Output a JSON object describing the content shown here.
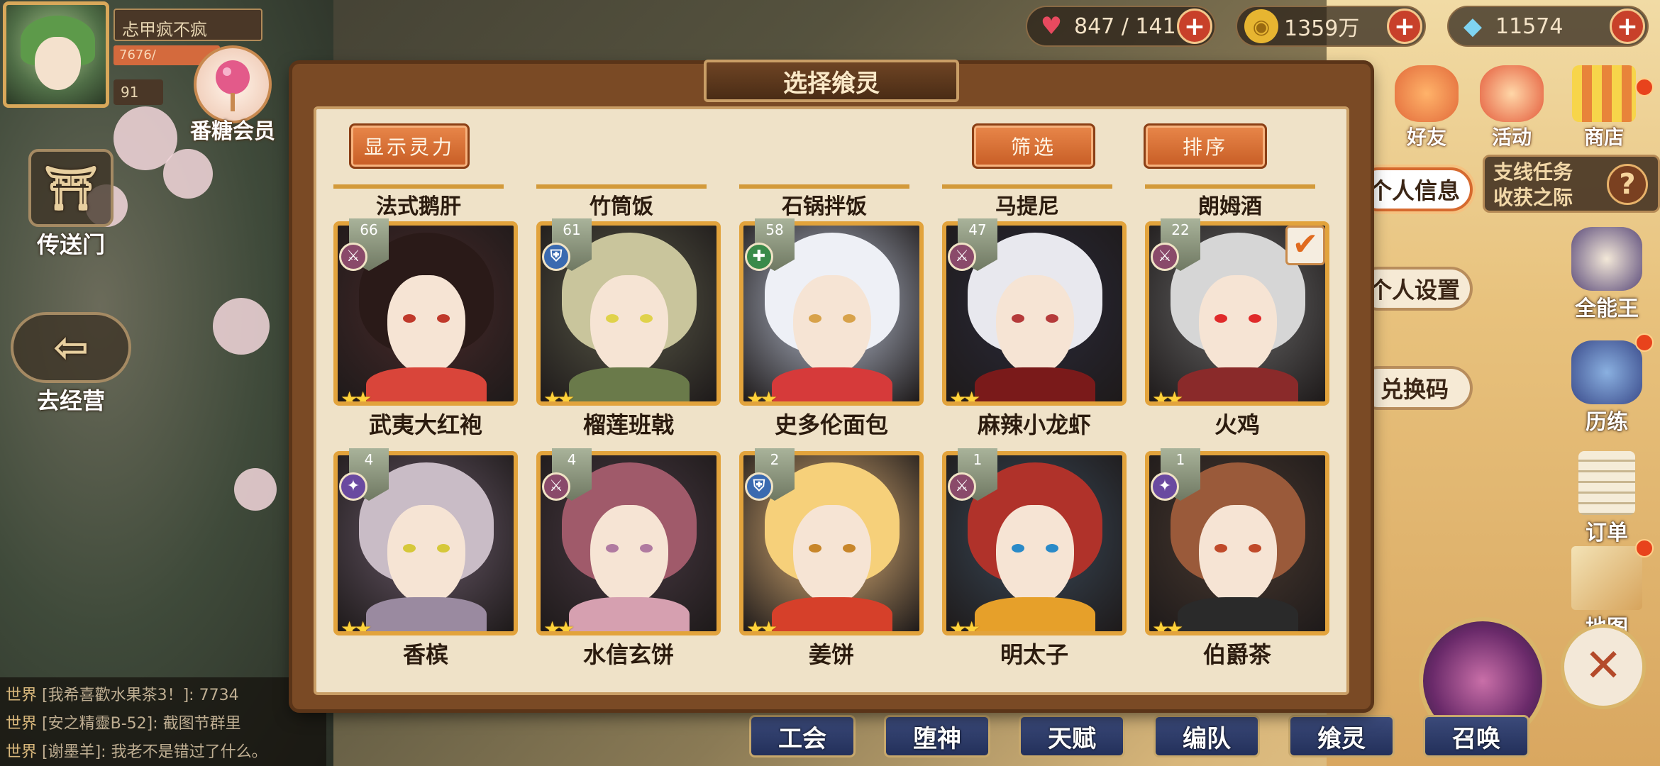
{
  "profile": {
    "player_name": "忐甲疯不疯",
    "exp_text": "7676/",
    "level": "91"
  },
  "left_menu": {
    "candy_member": "番糖会员",
    "portal": "传送门",
    "go_business": "去经营"
  },
  "resources": [
    {
      "icon": "heart-icon",
      "value": "847 / 141"
    },
    {
      "icon": "coin-icon",
      "value": "1359万"
    },
    {
      "icon": "crystal-icon",
      "value": "11574"
    }
  ],
  "top_right_icons": [
    {
      "label": "好友",
      "icon": "friends-icon"
    },
    {
      "label": "活动",
      "icon": "event-icon"
    },
    {
      "label": "商店",
      "icon": "shop-icon"
    }
  ],
  "side_menu": {
    "personal_info": "个人信息",
    "personal_settings": "个人设置",
    "redeem_code": "兑换码",
    "quest_line1": "支线任务",
    "quest_line2": "收获之际",
    "quest_help": "?"
  },
  "right_side": [
    {
      "label": "全能王"
    },
    {
      "label": "历练"
    },
    {
      "label": "订单"
    },
    {
      "label": "地图"
    }
  ],
  "chat": [
    {
      "channel": "世界",
      "text": "[我希喜歡水果茶3！]: 7734"
    },
    {
      "channel": "世界",
      "text": "[安之精靈B-52]: 截图节群里"
    },
    {
      "channel": "世界",
      "text": "[谢墨羊]: 我老不是错过了什么。"
    }
  ],
  "bottom_tabs": [
    "工会",
    "堕神",
    "天赋",
    "编队",
    "飨灵",
    "召唤"
  ],
  "modal": {
    "title": "选择飨灵",
    "show_power": "显示灵力",
    "filter": "筛选",
    "sort": "排序",
    "top_row_names": [
      "法式鹅肝",
      "竹筒饭",
      "石锅拌饭",
      "马提尼",
      "朗姆酒"
    ],
    "cards": [
      {
        "name": "武夷大红袍",
        "level": "66",
        "class": "⚔",
        "stars": "★★",
        "checked": false
      },
      {
        "name": "榴莲班戟",
        "level": "61",
        "class": "⛨",
        "stars": "★★",
        "checked": false
      },
      {
        "name": "史多伦面包",
        "level": "58",
        "class": "✚",
        "stars": "★★",
        "checked": false
      },
      {
        "name": "麻辣小龙虾",
        "level": "47",
        "class": "⚔",
        "stars": "★★",
        "checked": false
      },
      {
        "name": "火鸡",
        "level": "22",
        "class": "⚔",
        "stars": "★★",
        "checked": true
      },
      {
        "name": "香槟",
        "level": "4",
        "class": "✦",
        "stars": "★★",
        "checked": false
      },
      {
        "name": "水信玄饼",
        "level": "4",
        "class": "⚔",
        "stars": "★★",
        "checked": false
      },
      {
        "name": "姜饼",
        "level": "2",
        "class": "⛨",
        "stars": "★★",
        "checked": false
      },
      {
        "name": "明太子",
        "level": "1",
        "class": "⚔",
        "stars": "★★",
        "checked": false
      },
      {
        "name": "伯爵茶",
        "level": "1",
        "class": "✦",
        "stars": "★★",
        "checked": false
      }
    ]
  },
  "colors": {
    "card_frame": "#e2a33c",
    "button_orange": "#d9733a",
    "modal_brown": "#7a4a25",
    "parchment": "#efe2c8"
  }
}
